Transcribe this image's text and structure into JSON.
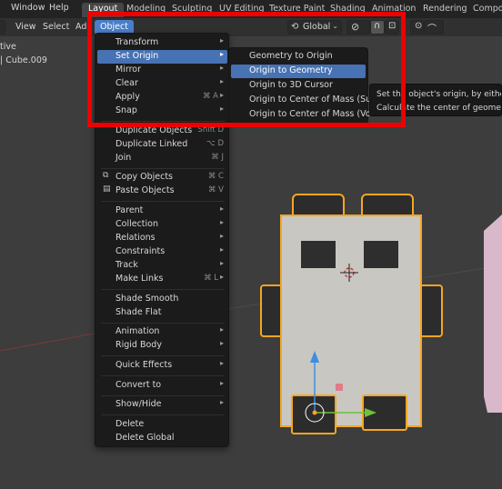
{
  "topmenu": {
    "window": "Window",
    "help": "Help"
  },
  "workspace_tabs": [
    "Layout",
    "Modeling",
    "Sculpting",
    "UV Editing",
    "Texture Paint",
    "Shading",
    "Animation",
    "Rendering",
    "Compo"
  ],
  "header": {
    "view": "View",
    "select": "Select",
    "add": "Add",
    "object": "Object",
    "orientation": "Global"
  },
  "viewport_text": {
    "line1": "tive",
    "line2": "| Cube.009"
  },
  "object_menu": {
    "transform": "Transform",
    "set_origin": "Set Origin",
    "mirror": "Mirror",
    "clear": "Clear",
    "apply": {
      "label": "Apply",
      "shortcut": "⌘ A"
    },
    "snap": "Snap",
    "duplicate_objects": {
      "label": "Duplicate Objects",
      "shortcut": "Shift D"
    },
    "duplicate_linked": {
      "label": "Duplicate Linked",
      "shortcut": "⌥ D"
    },
    "join": {
      "label": "Join",
      "shortcut": "⌘ J"
    },
    "copy_objects": {
      "label": "Copy Objects",
      "shortcut": "⌘ C"
    },
    "paste_objects": {
      "label": "Paste Objects",
      "shortcut": "⌘ V"
    },
    "parent": "Parent",
    "collection": "Collection",
    "relations": "Relations",
    "constraints": "Constraints",
    "track": "Track",
    "make_links": {
      "label": "Make Links",
      "shortcut": "⌘ L"
    },
    "shade_smooth": "Shade Smooth",
    "shade_flat": "Shade Flat",
    "animation": "Animation",
    "rigid_body": "Rigid Body",
    "quick_effects": "Quick Effects",
    "convert_to": "Convert to",
    "show_hide": "Show/Hide",
    "delete": "Delete",
    "delete_global": "Delete Global"
  },
  "set_origin_menu": {
    "geometry_to_origin": "Geometry to Origin",
    "origin_to_geometry": "Origin to Geometry",
    "origin_to_3d_cursor": "Origin to 3D Cursor",
    "origin_to_com_surface": "Origin to Center of Mass (Surface)",
    "origin_to_com_volume": "Origin to Center of Mass (Volume)"
  },
  "tooltip": {
    "line1": "Set the object's origin, by either moving",
    "line2": "Calculate the center of geometry based on"
  },
  "colors": {
    "highlight": "#4772b3",
    "selection_outline": "#f5a623",
    "annotation_box": "#ee0000",
    "mesh_fill": "#c9c7c2"
  }
}
